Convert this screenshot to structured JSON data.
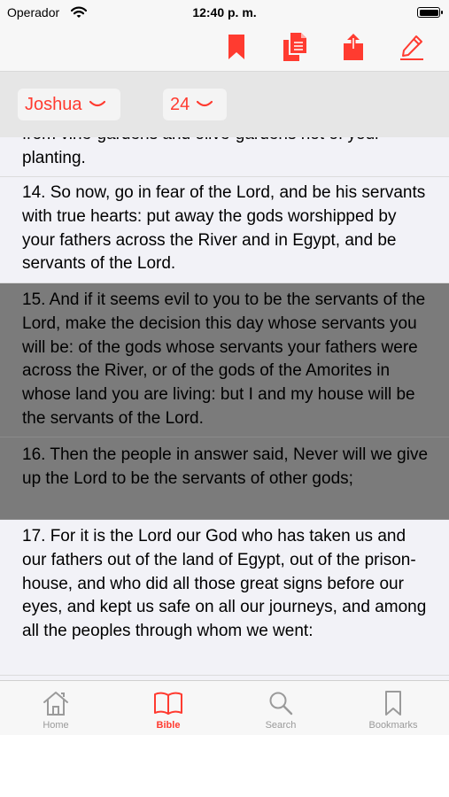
{
  "status_bar": {
    "carrier": "Operador",
    "time": "12:40 p. m."
  },
  "toolbar": {
    "accent": "#ff3b30",
    "actions": [
      {
        "icon": "bookmark-icon",
        "name": "bookmark-button"
      },
      {
        "icon": "copy-icon",
        "name": "copy-button"
      },
      {
        "icon": "share-icon",
        "name": "share-button"
      },
      {
        "icon": "pencil-icon",
        "name": "note-button"
      }
    ]
  },
  "selector": {
    "book": "Joshua",
    "chapter": "24"
  },
  "verses": [
    {
      "text": "from vine-gardens and olive-gardens not of your planting.",
      "selected": false
    },
    {
      "text": "14. So now, go in fear of the Lord, and be his servants with true hearts: put away the gods worshipped by your fathers across the River and in Egypt, and be servants of the Lord.",
      "selected": false
    },
    {
      "text": "15. And if it seems evil to you to be the servants of the Lord, make the decision this day whose servants you will be: of the gods whose servants your fathers were across the River, or of the gods of the Amorites in whose land you are living: but I and my house will be the servants of the Lord.",
      "selected": true
    },
    {
      "text": "16. Then the people in answer said, Never will we give up the Lord to be the servants of other gods;",
      "selected": true
    },
    {
      "text": "17. For it is the Lord our God who has taken us and our fathers out of the land of Egypt, out of the prison-house, and who did all those great signs before our eyes, and kept us safe on all our journeys, and among all the peoples through whom we went:",
      "selected": false
    }
  ],
  "tabs": [
    {
      "label": "Home",
      "icon": "home-icon",
      "active": false
    },
    {
      "label": "Bible",
      "icon": "book-icon",
      "active": true
    },
    {
      "label": "Search",
      "icon": "search-icon",
      "active": false
    },
    {
      "label": "Bookmarks",
      "icon": "bookmark-outline-icon",
      "active": false
    }
  ]
}
